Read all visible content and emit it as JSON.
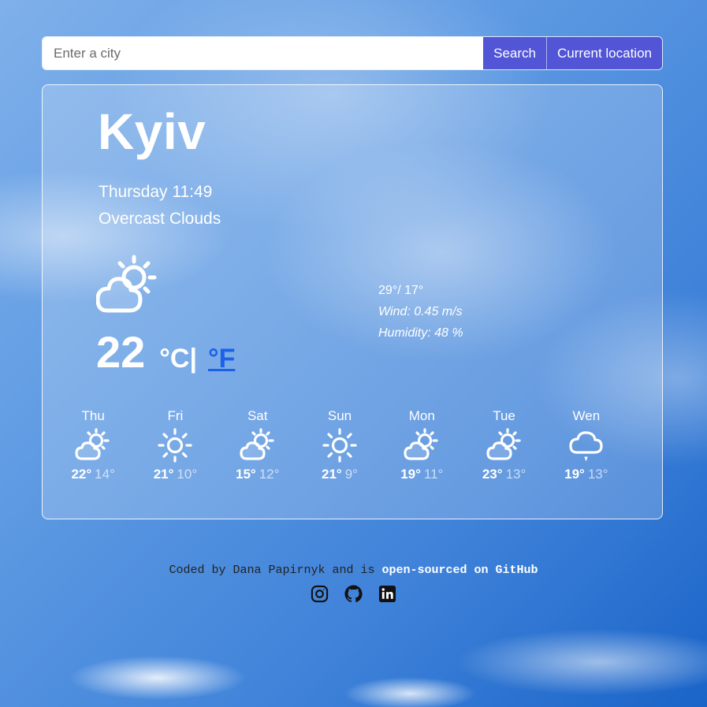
{
  "search": {
    "placeholder": "Enter a city",
    "search_label": "Search",
    "location_label": "Current location"
  },
  "weather": {
    "city": "Kyiv",
    "datetime": "Thursday 11:49",
    "description": "Overcast Clouds",
    "icon": "partly-cloudy-icon",
    "temperature": "22",
    "unit_c": "°C",
    "unit_sep": "|",
    "unit_f": "°F",
    "high_low": "29°/ 17°",
    "wind": "Wind: 0.45 m/s",
    "humidity": "Humidity: 48 %"
  },
  "forecast": [
    {
      "day": "Thu",
      "icon": "partly-cloudy-icon",
      "max": "22°",
      "min": "14°"
    },
    {
      "day": "Fri",
      "icon": "sun-icon",
      "max": "21°",
      "min": "10°"
    },
    {
      "day": "Sat",
      "icon": "partly-cloudy-icon",
      "max": "15°",
      "min": "12°"
    },
    {
      "day": "Sun",
      "icon": "sun-icon",
      "max": "21°",
      "min": "9°"
    },
    {
      "day": "Mon",
      "icon": "partly-cloudy-icon",
      "max": "19°",
      "min": "11°"
    },
    {
      "day": "Tue",
      "icon": "partly-cloudy-icon",
      "max": "23°",
      "min": "13°"
    },
    {
      "day": "Wen",
      "icon": "rain-cloud-icon",
      "max": "19°",
      "min": "13°"
    }
  ],
  "footer": {
    "text": "Coded by Dana Papirnyk and is ",
    "link": "open-sourced on GitHub",
    "icons": [
      "instagram-icon",
      "github-icon",
      "linkedin-icon"
    ]
  },
  "colors": {
    "button": "#5155d6",
    "link": "#1a62e8",
    "sky": "#3f82d9"
  }
}
